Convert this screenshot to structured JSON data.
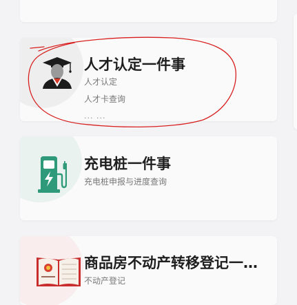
{
  "cards": [
    {
      "id": "top",
      "title": "",
      "lines": []
    },
    {
      "id": "talent",
      "title": "人才认定一件事",
      "lines": [
        "人才认定",
        "人才卡查询"
      ],
      "more": "... ..."
    },
    {
      "id": "charging",
      "title": "充电桩一件事",
      "lines": [
        "充电桩申报与进度查询"
      ]
    },
    {
      "id": "house",
      "title": "商品房不动产转移登记一…",
      "lines": [
        "不动产登记"
      ]
    }
  ],
  "icons": {
    "talent": "graduate-avatar-icon",
    "charging": "charging-station-icon",
    "house": "property-certificate-icon"
  },
  "colors": {
    "accent_green": "#2f9a7a",
    "certificate_red": "#c82c2c",
    "annotation_red": "#d81e1e"
  }
}
